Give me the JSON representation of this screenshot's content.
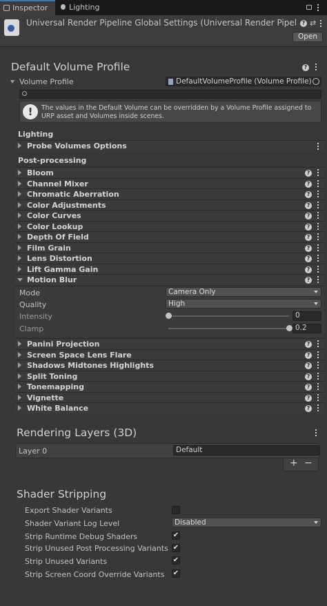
{
  "tabs": {
    "inspector": "Inspector",
    "lighting": "Lighting"
  },
  "header": {
    "title": "Universal Render Pipeline Global Settings (Universal Render Pipeline Globa",
    "open_label": "Open"
  },
  "default_volume": {
    "section_title": "Default Volume Profile",
    "profile_label": "Volume Profile",
    "profile_value": "DefaultVolumeProfile (Volume Profile)",
    "search_placeholder": "",
    "info_text": "The values in the Default Volume can be overridden by a Volume Profile assigned to URP asset and Volumes inside scenes.",
    "lighting_header": "Lighting",
    "probe_volumes": "Probe Volumes Options",
    "postprocessing_header": "Post-processing",
    "effects": [
      "Bloom",
      "Channel Mixer",
      "Chromatic Aberration",
      "Color Adjustments",
      "Color Curves",
      "Color Lookup",
      "Depth Of Field",
      "Film Grain",
      "Lens Distortion",
      "Lift Gamma Gain"
    ],
    "motion_blur": {
      "name": "Motion Blur",
      "mode_label": "Mode",
      "mode_value": "Camera Only",
      "quality_label": "Quality",
      "quality_value": "High",
      "intensity_label": "Intensity",
      "intensity_value": "0",
      "intensity_fraction": 0,
      "clamp_label": "Clamp",
      "clamp_value": "0.2",
      "clamp_fraction": 1
    },
    "effects_after": [
      "Panini Projection",
      "Screen Space Lens Flare",
      "Shadows Midtones Highlights",
      "Split Toning",
      "Tonemapping",
      "Vignette",
      "White Balance"
    ]
  },
  "rendering_layers": {
    "section_title": "Rendering Layers (3D)",
    "layer_label": "Layer 0",
    "layer_value": "Default",
    "add": "+",
    "remove": "−"
  },
  "shader_stripping": {
    "section_title": "Shader Stripping",
    "export_label": "Export Shader Variants",
    "export_checked": false,
    "log_level_label": "Shader Variant Log Level",
    "log_level_value": "Disabled",
    "strip_debug_label": "Strip Runtime Debug Shaders",
    "strip_debug_checked": true,
    "strip_post_label": "Strip Unused Post Processing Variants",
    "strip_post_checked": true,
    "strip_unused_label": "Strip Unused Variants",
    "strip_unused_checked": true,
    "strip_screen_label": "Strip Screen Coord Override Variants",
    "strip_screen_checked": true
  },
  "colors": {
    "accent": "#3a79bb",
    "background": "#383838",
    "field": "#2a2a2a"
  }
}
